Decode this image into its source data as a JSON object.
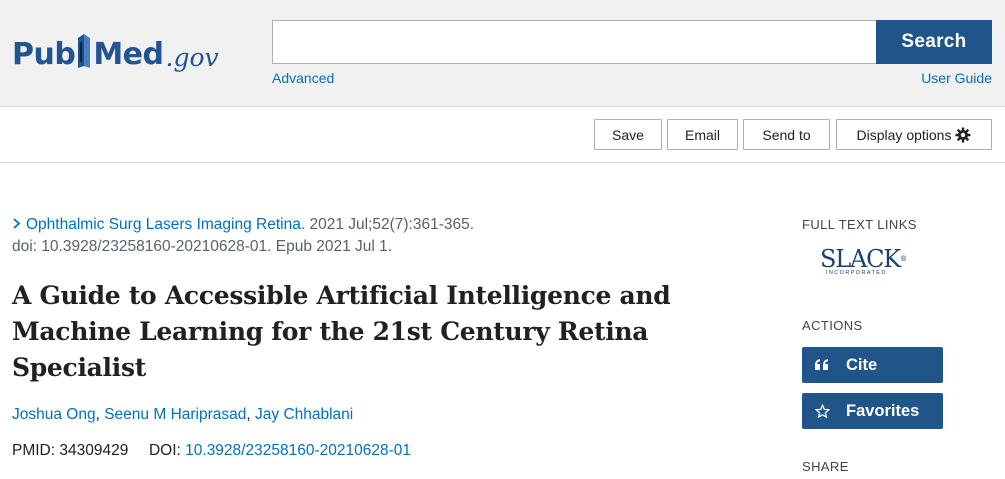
{
  "header": {
    "logo": {
      "pub": "Pub",
      "med": "Med",
      "gov": ".gov"
    },
    "search": {
      "placeholder": "",
      "value": "",
      "button_label": "Search"
    },
    "advanced_link": "Advanced",
    "user_guide_link": "User Guide",
    "brand_color": "#20558a"
  },
  "toolbar": {
    "save_label": "Save",
    "email_label": "Email",
    "send_to_label": "Send to",
    "display_options_label": "Display options",
    "display_options_icon": "gear-icon"
  },
  "article": {
    "journal": "Ophthalmic Surg Lasers Imaging Retina",
    "citation_rest": ". 2021 Jul;52(7):361-365.",
    "doi_line": "doi: 10.3928/23258160-20210628-01. Epub 2021 Jul 1.",
    "title": "A Guide to Accessible Artificial Intelligence and Machine Learning for the 21st Century Retina Specialist",
    "authors": [
      "Joshua Ong",
      "Seenu M Hariprasad",
      "Jay Chhablani"
    ],
    "pmid_label": "PMID: ",
    "pmid": "34309429",
    "doi_label": "DOI: ",
    "doi": "10.3928/23258160-20210628-01"
  },
  "sidebar": {
    "full_text_heading": "FULL TEXT LINKS",
    "publisher_logo": {
      "name": "SLACK",
      "sub": "INCORPORATED",
      "mark": "®"
    },
    "actions_heading": "ACTIONS",
    "cite_label": "Cite",
    "cite_icon": "quote-icon",
    "favorites_label": "Favorites",
    "favorites_icon": "star-icon",
    "share_heading": "SHARE"
  }
}
